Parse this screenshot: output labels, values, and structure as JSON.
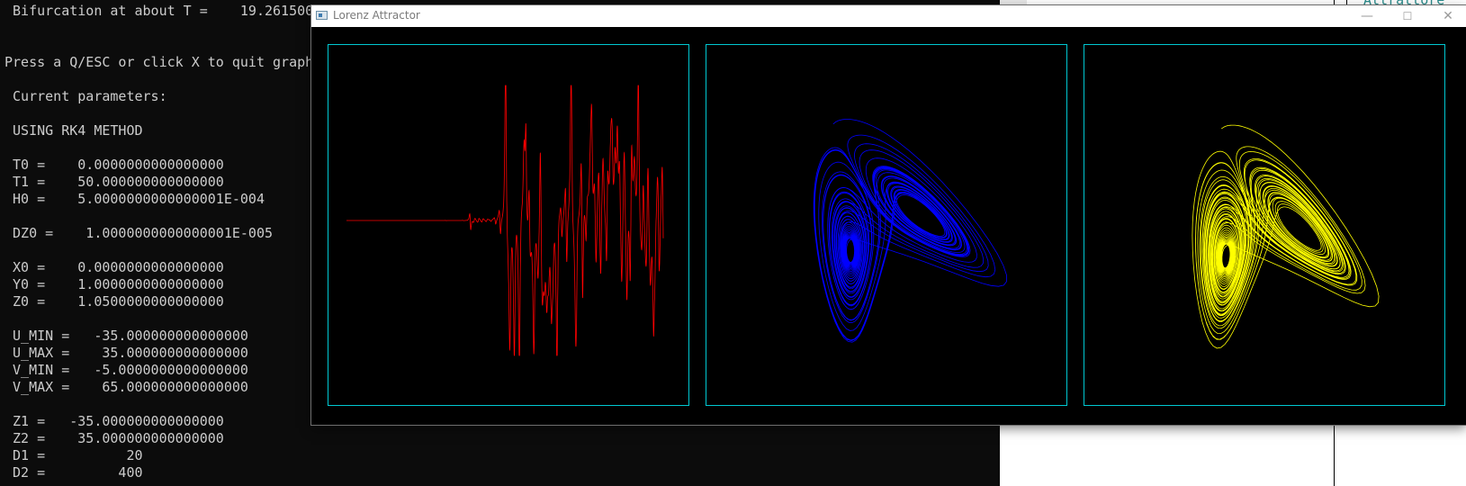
{
  "console": {
    "lines": [
      " Bifurcation at about T =    19.261500",
      "",
      "",
      "Press a Q/ESC or click X to quit graph",
      "",
      " Current parameters:",
      "",
      " USING RK4 METHOD",
      "",
      " T0 =    0.0000000000000000",
      " T1 =    50.000000000000000",
      " H0 =    5.0000000000000001E-004",
      "",
      " DZ0 =    1.0000000000000001E-005",
      "",
      " X0 =    0.0000000000000000",
      " Y0 =    1.0000000000000000",
      " Z0 =    1.0500000000000000",
      "",
      " U_MIN =   -35.000000000000000",
      " U_MAX =    35.000000000000000",
      " V_MIN =   -5.0000000000000000",
      " V_MAX =    65.000000000000000",
      "",
      " Z1 =   -35.000000000000000",
      " Z2 =    35.000000000000000",
      " D1 =          20",
      " D2 =         400"
    ]
  },
  "background_window": {
    "partial_text": "Attrattore"
  },
  "window": {
    "title": "Lorenz Attractor",
    "minimize_glyph": "—",
    "maximize_glyph": "☐",
    "close_glyph": "✕"
  },
  "plots": [
    {
      "name": "divergence-plot",
      "color": "#ff0000"
    },
    {
      "name": "attractor-plot-blue",
      "color": "#0000ff"
    },
    {
      "name": "attractor-plot-yellow",
      "color": "#ffff00"
    }
  ],
  "colors": {
    "frame": "#00c8d2",
    "console_bg": "#0c0c0c",
    "console_fg": "#cccccc"
  }
}
